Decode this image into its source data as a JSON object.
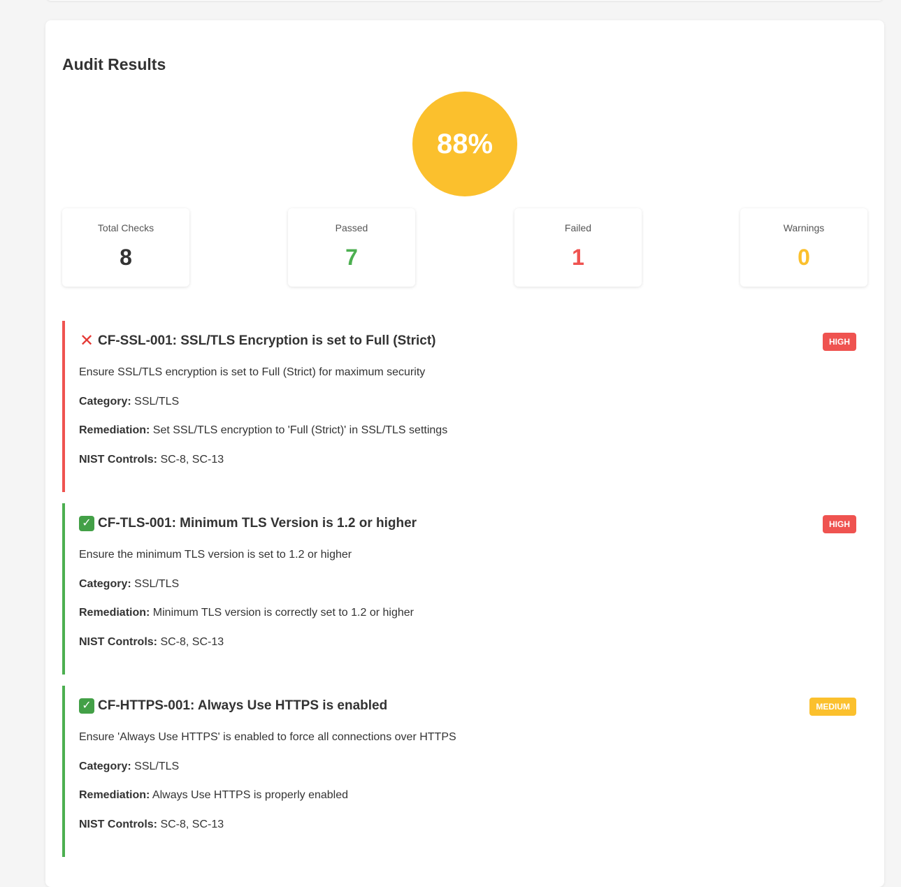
{
  "title": "Audit Results",
  "score": {
    "value": "88%",
    "color": "#fbc02d"
  },
  "stats": [
    {
      "label": "Total Checks",
      "value": "8",
      "color": "#333333"
    },
    {
      "label": "Passed",
      "value": "7",
      "color": "#4caf50"
    },
    {
      "label": "Failed",
      "value": "1",
      "color": "#ef5350"
    },
    {
      "label": "Warnings",
      "value": "0",
      "color": "#fbc02d"
    }
  ],
  "labels": {
    "category": "Category:",
    "remediation": "Remediation:",
    "nist": "NIST Controls:"
  },
  "checks": [
    {
      "status": "fail",
      "status_icon": "cross-icon",
      "border_color": "#ef5350",
      "title": "CF-SSL-001: SSL/TLS Encryption is set to Full (Strict)",
      "severity": "HIGH",
      "severity_color": "#ef5350",
      "description": "Ensure SSL/TLS encryption is set to Full (Strict) for maximum security",
      "category": "SSL/TLS",
      "remediation": "Set SSL/TLS encryption to 'Full (Strict)' in SSL/TLS settings",
      "nist_controls": "SC-8, SC-13"
    },
    {
      "status": "pass",
      "status_icon": "check-icon",
      "border_color": "#4caf50",
      "title": "CF-TLS-001: Minimum TLS Version is 1.2 or higher",
      "severity": "HIGH",
      "severity_color": "#ef5350",
      "description": "Ensure the minimum TLS version is set to 1.2 or higher",
      "category": "SSL/TLS",
      "remediation": "Minimum TLS version is correctly set to 1.2 or higher",
      "nist_controls": "SC-8, SC-13"
    },
    {
      "status": "pass",
      "status_icon": "check-icon",
      "border_color": "#4caf50",
      "title": "CF-HTTPS-001: Always Use HTTPS is enabled",
      "severity": "MEDIUM",
      "severity_color": "#fbc02d",
      "description": "Ensure 'Always Use HTTPS' is enabled to force all connections over HTTPS",
      "category": "SSL/TLS",
      "remediation": "Always Use HTTPS is properly enabled",
      "nist_controls": "SC-8, SC-13"
    }
  ]
}
